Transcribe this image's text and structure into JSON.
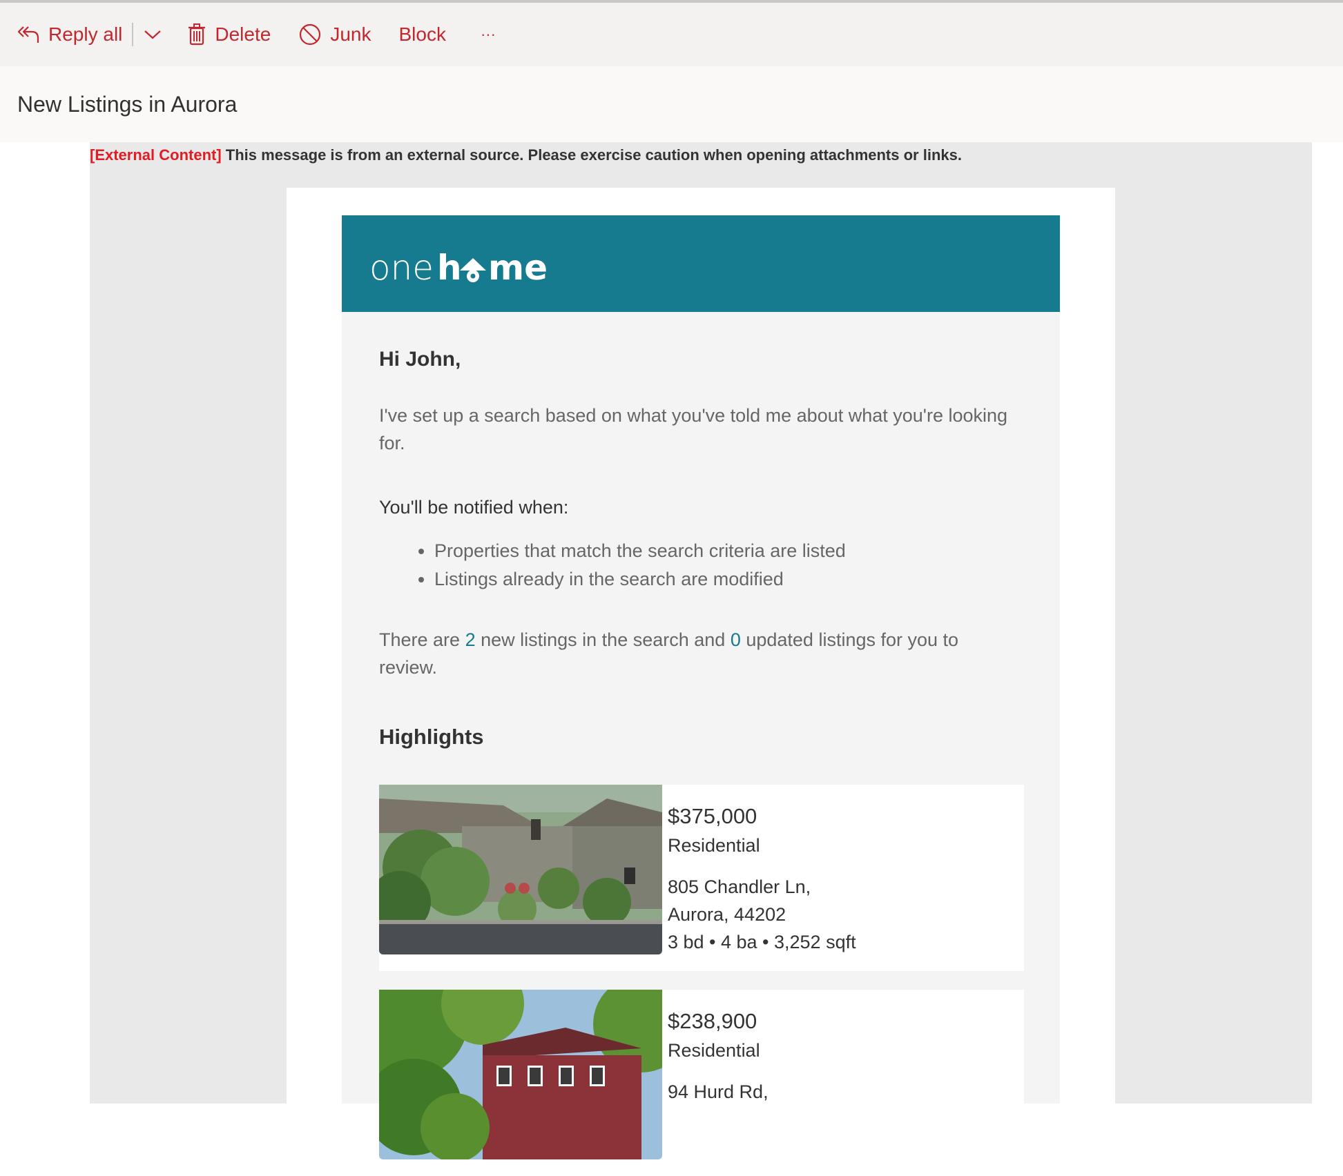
{
  "toolbar": {
    "reply_all": "Reply all",
    "delete": "Delete",
    "junk": "Junk",
    "block": "Block",
    "more": "···"
  },
  "subject": "New Listings in Aurora",
  "warning": {
    "tag": "[External Content]",
    "text": " This message is from an external source. Please exercise caution when opening attachments or links."
  },
  "brand": {
    "name": "onehome"
  },
  "email": {
    "greeting": "Hi John,",
    "intro": "I've set up a search based on what you've told me about what you're looking for.",
    "notify_heading": "You'll be notified when:",
    "bullets": [
      "Properties that match the search criteria are listed",
      "Listings already in the search are modified"
    ],
    "summary_pre": "There are ",
    "new_count": "2",
    "summary_mid": " new listings in the search and ",
    "updated_count": "0",
    "summary_post": " updated listings for you to review.",
    "highlights_heading": "Highlights"
  },
  "listings": [
    {
      "price": "$375,000",
      "type": "Residential",
      "street": "805 Chandler Ln,",
      "city": "Aurora, 44202",
      "specs": "3 bd • 4 ba • 3,252 sqft"
    },
    {
      "price": "$238,900",
      "type": "Residential",
      "street": "94 Hurd Rd,"
    }
  ],
  "colors": {
    "accent": "#c4262e",
    "brand_teal": "#167b8f",
    "warning_red": "#e31b23"
  },
  "icons": [
    "reply-all-icon",
    "chevron-down-icon",
    "trash-icon",
    "block-circle-icon",
    "more-icon"
  ]
}
